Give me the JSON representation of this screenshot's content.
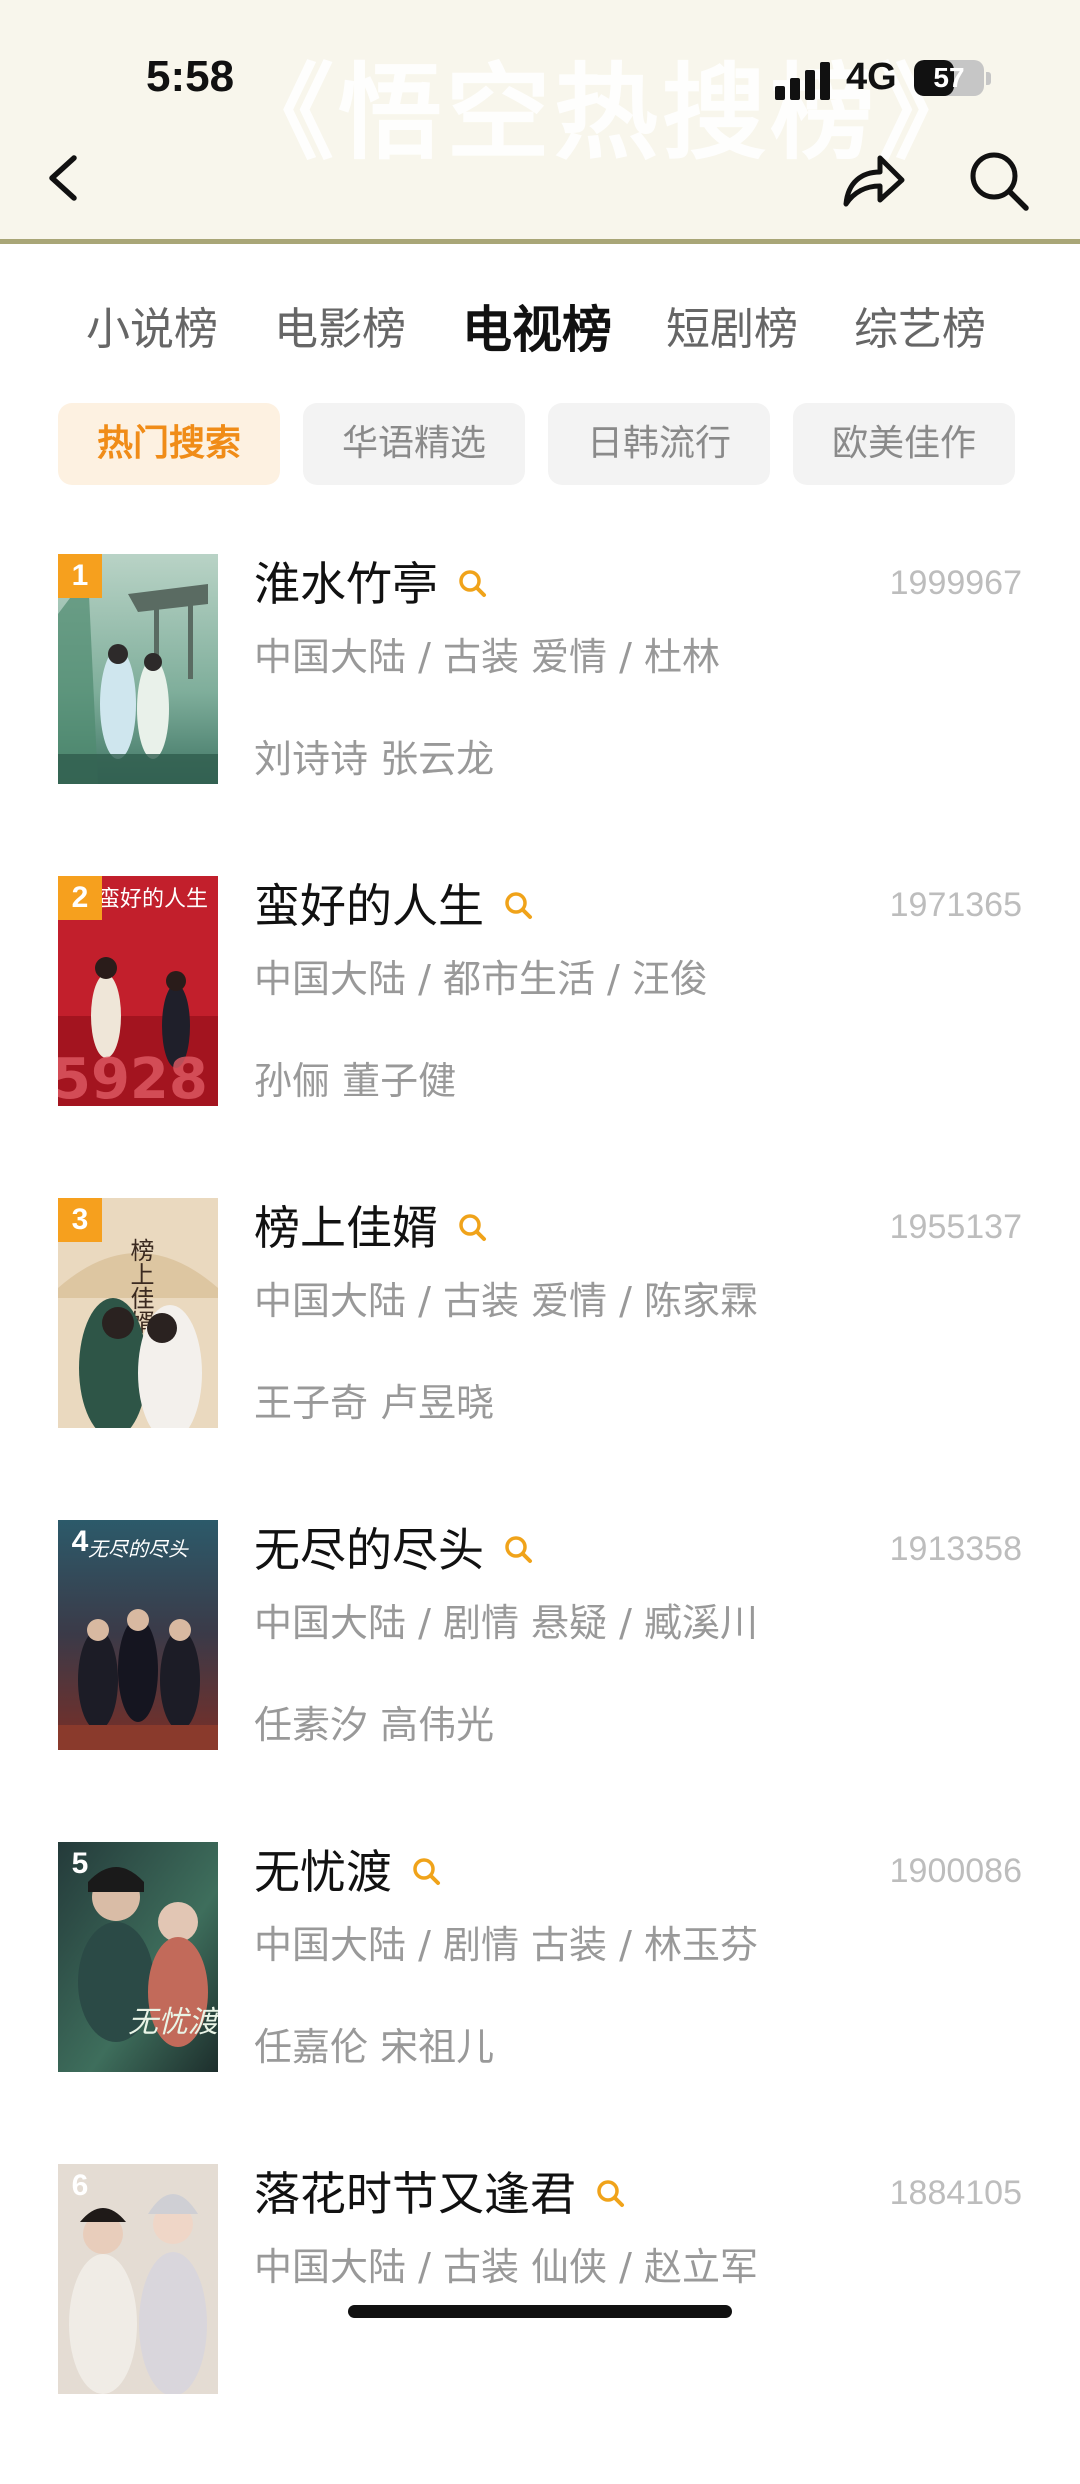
{
  "status_bar": {
    "time": "5:58",
    "network": "4G",
    "battery": "57",
    "battery_level": 0.57
  },
  "header": {
    "watermark": "《悟空热搜榜》"
  },
  "icons": {
    "back": "chevron-left-icon",
    "share": "share-arrow-icon",
    "search": "search-icon"
  },
  "category_tabs": [
    {
      "label": "小说榜",
      "active": false
    },
    {
      "label": "电影榜",
      "active": false
    },
    {
      "label": "电视榜",
      "active": true
    },
    {
      "label": "短剧榜",
      "active": false
    },
    {
      "label": "综艺榜",
      "active": false
    }
  ],
  "filter_chips": [
    {
      "label": "热门搜索",
      "active": true
    },
    {
      "label": "华语精选",
      "active": false
    },
    {
      "label": "日韩流行",
      "active": false
    },
    {
      "label": "欧美佳作",
      "active": false
    }
  ],
  "colors": {
    "accent": "#f08c18",
    "rank_badge": "#f6a01e",
    "header_bg": "#f8f6ec",
    "header_line": "#a9a677"
  },
  "items": [
    {
      "rank": "1",
      "title": "淮水竹亭",
      "score": "1999967",
      "meta": "中国大陆 / 古装 爱情 / 杜林",
      "cast": "刘诗诗 张云龙"
    },
    {
      "rank": "2",
      "title": "蛮好的人生",
      "score": "1971365",
      "meta": "中国大陆 / 都市生活 / 汪俊",
      "cast": "孙俪 董子健",
      "poster_text": "蛮好的人生"
    },
    {
      "rank": "3",
      "title": "榜上佳婿",
      "score": "1955137",
      "meta": "中国大陆 / 古装 爱情 / 陈家霖",
      "cast": "王子奇 卢昱晓",
      "poster_text": "榜上佳婿"
    },
    {
      "rank": "4",
      "title": "无尽的尽头",
      "score": "1913358",
      "meta": "中国大陆 / 剧情 悬疑 / 臧溪川",
      "cast": "任素汐 高伟光",
      "poster_text": "无尽的尽头"
    },
    {
      "rank": "5",
      "title": "无忧渡",
      "score": "1900086",
      "meta": "中国大陆 / 剧情 古装 / 林玉芬",
      "cast": "任嘉伦 宋祖儿",
      "poster_text": "无忧渡"
    },
    {
      "rank": "6",
      "title": "落花时节又逢君",
      "score": "1884105",
      "meta": "中国大陆 / 古装 仙侠 / 赵立军",
      "cast": ""
    }
  ]
}
